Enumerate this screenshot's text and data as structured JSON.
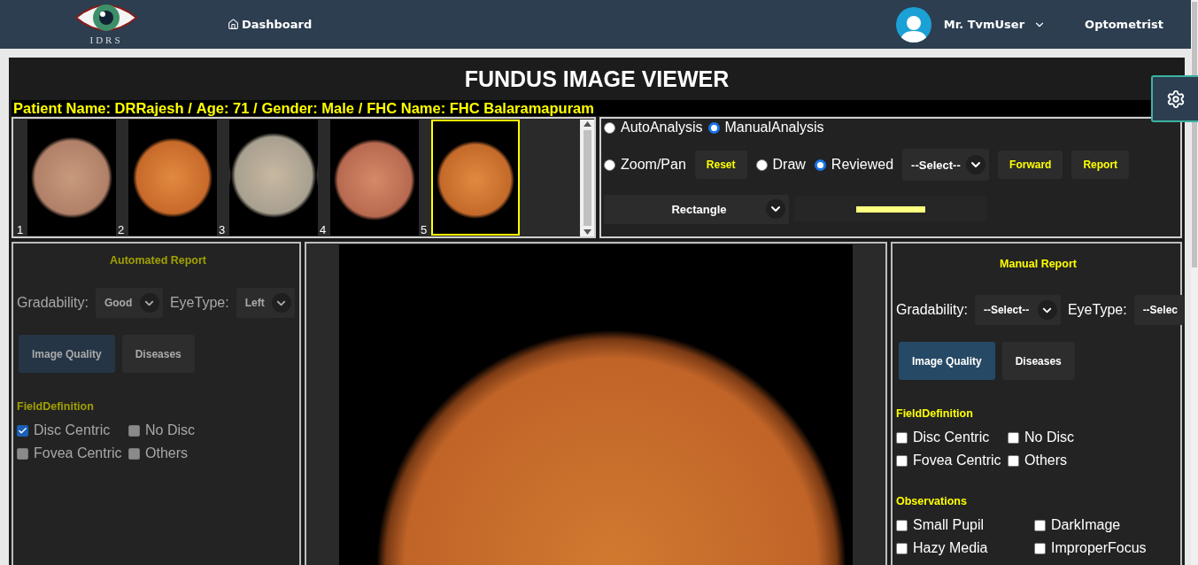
{
  "header": {
    "logo_text": "IDRS",
    "nav": [
      {
        "label": "Dashboard"
      }
    ],
    "user": {
      "name": "Mr. TvmUser",
      "role": "Optometrist"
    }
  },
  "viewer": {
    "title": "FUNDUS IMAGE VIEWER",
    "patient": [
      "Patient Name: DRRajesh /",
      "Age: 71 /",
      "Gender: Male /",
      "FHC Name: FHC Balaramapuram"
    ]
  },
  "thumbnails": [
    {
      "number": "1",
      "selected": false
    },
    {
      "number": "2",
      "selected": false
    },
    {
      "number": "3",
      "selected": false
    },
    {
      "number": "4",
      "selected": false
    },
    {
      "number": "5",
      "selected": true
    }
  ],
  "controls": {
    "analysis": [
      {
        "label": "AutoAnalysis",
        "selected": false
      },
      {
        "label": "ManualAnalysis",
        "selected": true
      }
    ],
    "tools": [
      {
        "kind": "radio",
        "label": "Zoom/Pan",
        "selected": false
      },
      {
        "kind": "button",
        "label": "Reset"
      },
      {
        "kind": "radio",
        "label": "Draw",
        "selected": false
      },
      {
        "kind": "radio",
        "label": "Reviewed",
        "selected": true
      },
      {
        "kind": "select",
        "label": "--Select--"
      },
      {
        "kind": "button",
        "label": "Forward"
      },
      {
        "kind": "button",
        "label": "Report"
      }
    ],
    "shape": {
      "value": "Rectangle"
    }
  },
  "reports": [
    {
      "title": "Automated Report",
      "disabled": true,
      "gradability": {
        "label": "Gradability:",
        "value": "Good"
      },
      "eyetype": {
        "label": "EyeType:",
        "value": "Left"
      },
      "tabs": [
        {
          "label": "Image Quality",
          "selected": true
        },
        {
          "label": "Diseases",
          "selected": false
        }
      ],
      "sections": [
        {
          "heading": "FieldDefinition",
          "options": [
            {
              "label": "Disc Centric",
              "checked": true
            },
            {
              "label": "No Disc",
              "checked": false
            },
            {
              "label": "Fovea Centric",
              "checked": false
            },
            {
              "label": "Others",
              "checked": false
            }
          ]
        }
      ]
    },
    {
      "title": "Manual Report",
      "disabled": false,
      "gradability": {
        "label": "Gradability:",
        "value": "--Select--"
      },
      "eyetype": {
        "label": "EyeType:",
        "value": "--Selec"
      },
      "tabs": [
        {
          "label": "Image Quality",
          "selected": true
        },
        {
          "label": "Diseases",
          "selected": false
        }
      ],
      "sections": [
        {
          "heading": "FieldDefinition",
          "options": [
            {
              "label": "Disc Centric",
              "checked": false
            },
            {
              "label": "No Disc",
              "checked": false
            },
            {
              "label": "Fovea Centric",
              "checked": false
            },
            {
              "label": "Others",
              "checked": false
            }
          ]
        },
        {
          "heading": "Observations",
          "wide": true,
          "options": [
            {
              "label": "Small Pupil",
              "checked": false
            },
            {
              "label": "DarkImage",
              "checked": false
            },
            {
              "label": "Hazy Media",
              "checked": false
            },
            {
              "label": "ImproperFocus",
              "checked": false
            }
          ]
        }
      ]
    }
  ]
}
